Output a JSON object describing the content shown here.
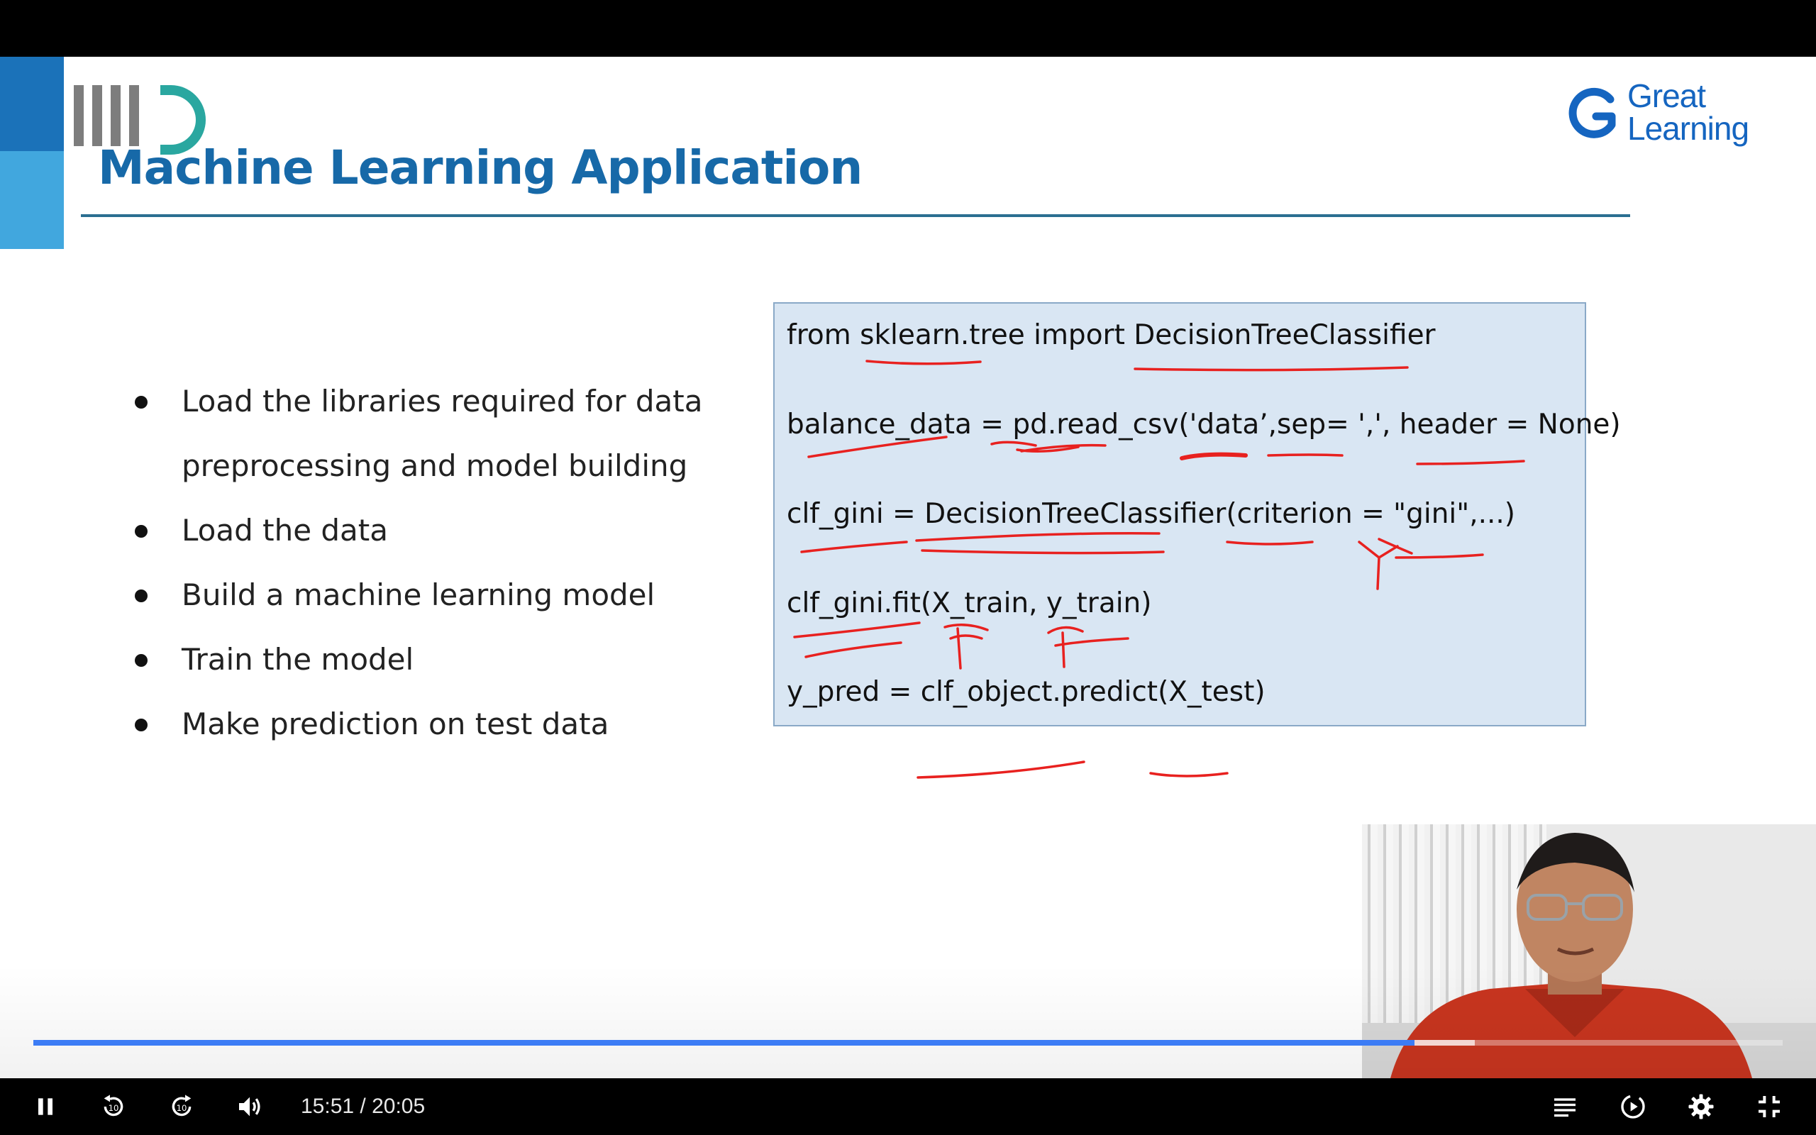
{
  "slide": {
    "title": "Machine Learning Application",
    "brand": {
      "institute_logo": "iiitd-logo",
      "company_line1": "Great",
      "company_line2": "Learning"
    },
    "bullets": [
      "Load the libraries required for data preprocessing and model building",
      "Load the data",
      "Build a machine learning model",
      "Train the model",
      "Make prediction on test data"
    ],
    "code_lines": [
      "from sklearn.tree import DecisionTreeClassifier",
      "balance_data = pd.read_csv('data’,sep= ',', header = None)",
      "clf_gini = DecisionTreeClassifier(criterion = \"gini\",...)",
      "clf_gini.fit(X_train, y_train)",
      "y_pred = clf_object.predict(X_test)"
    ]
  },
  "player": {
    "current_time": "15:51",
    "duration": "20:05",
    "time_display": "15:51 / 20:05",
    "progress_fraction": 0.7896,
    "buffered_fraction": 0.824,
    "accent_color": "#3c7cf5",
    "icons": {
      "play_pause": "pause-icon",
      "rewind": "rewind-10-icon",
      "forward": "forward-10-icon",
      "volume": "volume-icon",
      "chapters": "chapters-icon",
      "autoplay": "autoplay-icon",
      "settings": "gear-icon",
      "fullscreen": "exit-fullscreen-icon"
    }
  }
}
